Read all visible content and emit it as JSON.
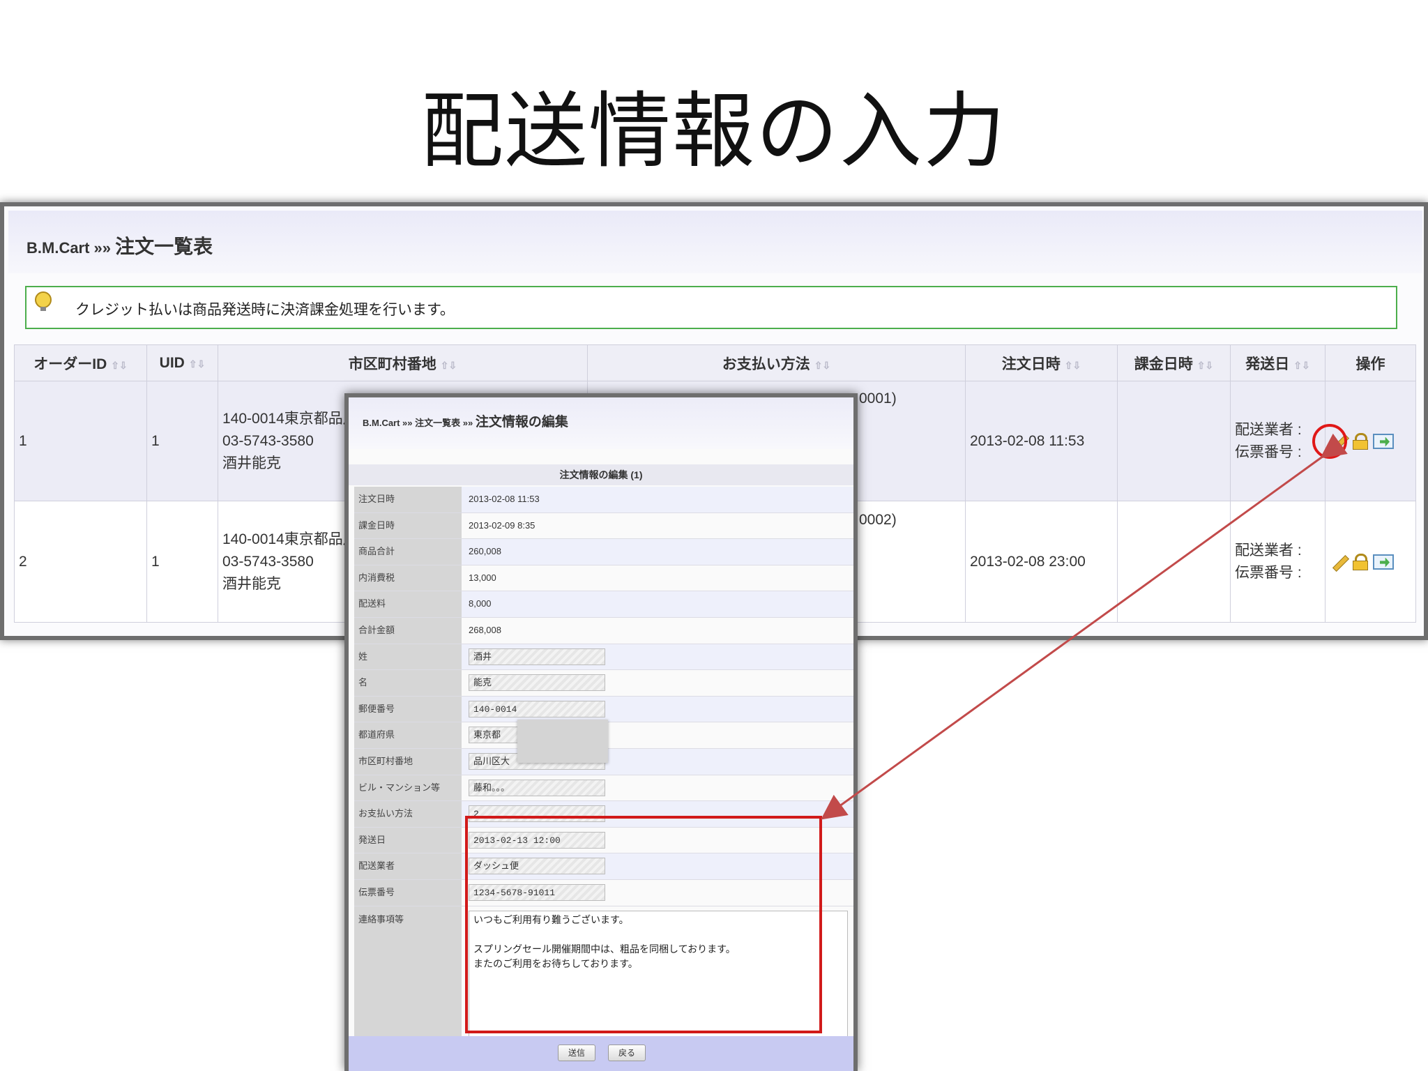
{
  "slide": {
    "title": "配送情報の入力"
  },
  "list_view": {
    "breadcrumb_root": "B.M.Cart »»",
    "breadcrumb_page": "注文一覧表",
    "notice": "クレジット払いは商品発送時に決済課金処理を行います。",
    "columns": [
      "オーダーID",
      "UID",
      "市区町村番地",
      "お支払い方法",
      "注文日時",
      "課金日時",
      "発送日",
      "操作"
    ],
    "rows": [
      {
        "order_id": "1",
        "uid": "1",
        "address": [
          "140-0014東京都品川",
          "03-5743-3580",
          "酒井能克"
        ],
        "payment_visible": "0001)",
        "ordered_at": "2013-02-08 11:53",
        "charged_at": "",
        "ship_info": [
          "配送業者 :",
          "伝票番号 :"
        ]
      },
      {
        "order_id": "2",
        "uid": "1",
        "address": [
          "140-0014東京都品川",
          "03-5743-3580",
          "酒井能克"
        ],
        "payment_visible": "0002)",
        "ordered_at": "2013-02-08 23:00",
        "charged_at": "",
        "ship_info": [
          "配送業者 :",
          "伝票番号 :"
        ]
      }
    ],
    "icons": [
      "pencil-icon",
      "lock-icon",
      "mail-icon"
    ]
  },
  "edit_dialog": {
    "breadcrumb_root": "B.M.Cart »» 注文一覧表 »»",
    "breadcrumb_page": "注文情報の編集",
    "section_title": "注文情報の編集 (1)",
    "fields": {
      "order_date": {
        "label": "注文日時",
        "value": "2013-02-08 11:53"
      },
      "charge_date": {
        "label": "課金日時",
        "value": "2013-02-09 8:35"
      },
      "subtotal": {
        "label": "商品合計",
        "value": "260,008"
      },
      "tax": {
        "label": "内消費税",
        "value": "13,000"
      },
      "shipping_fee": {
        "label": "配送料",
        "value": "8,000"
      },
      "total": {
        "label": "合計金額",
        "value": "268,008"
      },
      "last_name": {
        "label": "姓",
        "value": "酒井"
      },
      "first_name": {
        "label": "名",
        "value": "能克"
      },
      "postal_code": {
        "label": "郵便番号",
        "value": "140-0014"
      },
      "prefecture": {
        "label": "都道府県",
        "value": "東京都"
      },
      "city_address": {
        "label": "市区町村番地",
        "value": "品川区大"
      },
      "building": {
        "label": "ビル・マンション等",
        "value": "藤和。。。"
      },
      "payment": {
        "label": "お支払い方法",
        "value": "2"
      },
      "ship_date": {
        "label": "発送日",
        "value": "2013-02-13 12:00"
      },
      "carrier": {
        "label": "配送業者",
        "value": "ダッシュ便"
      },
      "tracking_no": {
        "label": "伝票番号",
        "value": "1234-5678-91011"
      },
      "notes": {
        "label": "連絡事項等",
        "value": "いつもご利用有り難うございます。\n\nスプリングセール開催期間中は、粗品を同梱しております。\nまたのご利用をお待ちしております。"
      }
    },
    "buttons": {
      "submit": "送信",
      "back": "戻る"
    }
  },
  "colors": {
    "highlight": "#d11a1a",
    "arrow": "#c24a4a",
    "notice_border": "#4cae4c"
  }
}
